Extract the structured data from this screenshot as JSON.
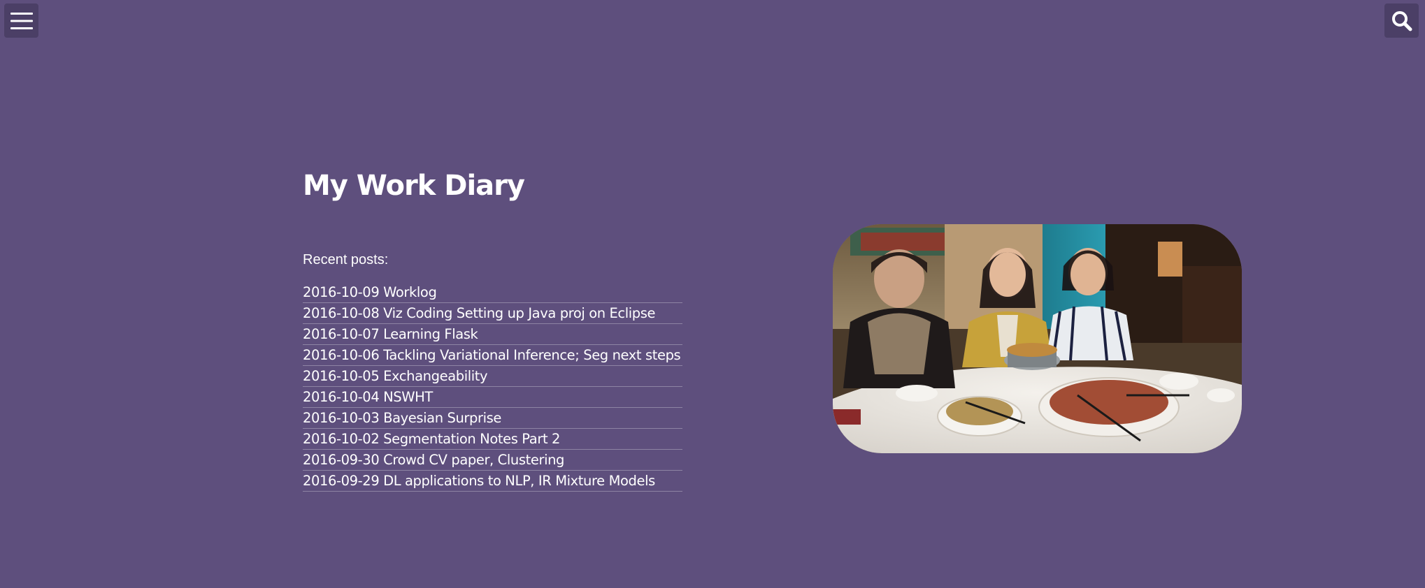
{
  "header": {
    "menu_icon": "hamburger-menu-icon",
    "search_icon": "search-icon"
  },
  "main": {
    "title": "My Work Diary",
    "recent_label": "Recent posts:",
    "posts": [
      {
        "label": "2016-10-09 Worklog"
      },
      {
        "label": "2016-10-08 Viz Coding Setting up Java proj on Eclipse"
      },
      {
        "label": "2016-10-07 Learning Flask"
      },
      {
        "label": "2016-10-06 Tackling Variational Inference; Seg next steps"
      },
      {
        "label": "2016-10-05 Exchangeability"
      },
      {
        "label": "2016-10-04 NSWHT"
      },
      {
        "label": "2016-10-03 Bayesian Surprise"
      },
      {
        "label": "2016-10-02 Segmentation Notes Part 2"
      },
      {
        "label": "2016-09-30 Crowd CV paper, Clustering"
      },
      {
        "label": "2016-09-29 DL applications to NLP, IR Mixture Models"
      }
    ]
  },
  "colors": {
    "background": "#5e4f7d",
    "button_bg": "#4b3f66",
    "text": "#ffffff"
  }
}
